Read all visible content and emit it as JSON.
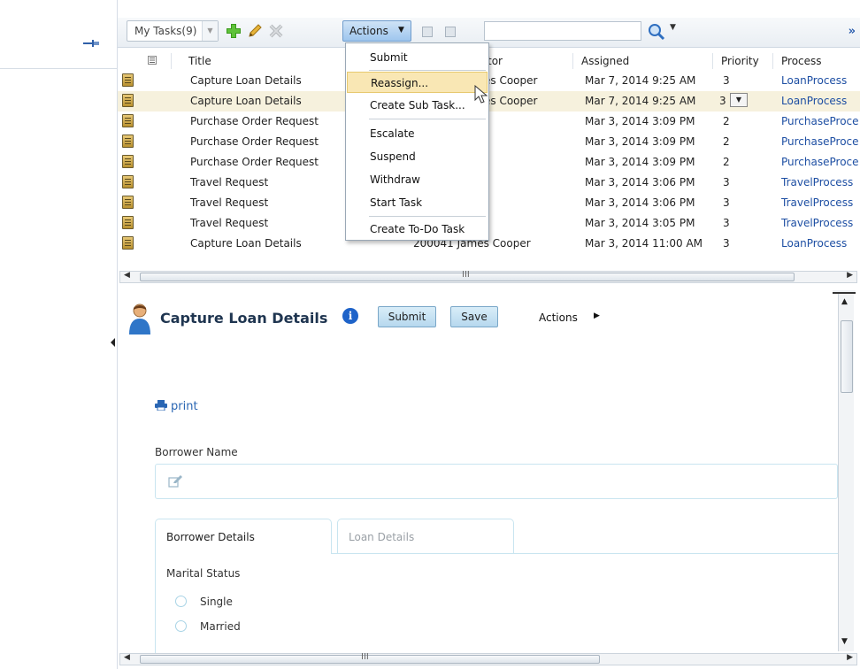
{
  "toolbar": {
    "task_filter": "My Tasks(9)",
    "actions_label": "Actions",
    "search_value": ""
  },
  "table": {
    "columns": [
      "Title",
      "tor",
      "Assigned",
      "Priority",
      "Process"
    ],
    "rows": [
      {
        "title": "Capture Loan Details",
        "creator": "es Cooper",
        "assigned": "Mar 7, 2014 9:25 AM",
        "priority": "3",
        "process": "LoanProcess"
      },
      {
        "title": "Capture Loan Details",
        "creator": "es Cooper",
        "assigned": "Mar 7, 2014 9:25 AM",
        "priority": "3",
        "process": "LoanProcess"
      },
      {
        "title": "Purchase Order Request",
        "creator": "",
        "assigned": "Mar 3, 2014 3:09 PM",
        "priority": "2",
        "process": "PurchaseProce"
      },
      {
        "title": "Purchase Order Request",
        "creator": "",
        "assigned": "Mar 3, 2014 3:09 PM",
        "priority": "2",
        "process": "PurchaseProce"
      },
      {
        "title": "Purchase Order Request",
        "creator": "",
        "assigned": "Mar 3, 2014 3:09 PM",
        "priority": "2",
        "process": "PurchaseProce"
      },
      {
        "title": "Travel Request",
        "creator": "",
        "assigned": "Mar 3, 2014 3:06 PM",
        "priority": "3",
        "process": "TravelProcess"
      },
      {
        "title": "Travel Request",
        "creator": "",
        "assigned": "Mar 3, 2014 3:06 PM",
        "priority": "3",
        "process": "TravelProcess"
      },
      {
        "title": "Travel Request",
        "creator": "",
        "assigned": "Mar 3, 2014 3:05 PM",
        "priority": "3",
        "process": "TravelProcess"
      },
      {
        "title": "Capture Loan Details",
        "creator": "200041 James Cooper",
        "assigned": "Mar 3, 2014 11:00 AM",
        "priority": "3",
        "process": "LoanProcess"
      }
    ]
  },
  "actions_menu": {
    "items": [
      "Submit",
      "Reassign...",
      "Create Sub Task...",
      "Escalate",
      "Suspend",
      "Withdraw",
      "Start Task",
      "Create To-Do Task"
    ],
    "highlighted": "Reassign..."
  },
  "scrollbar_grip": "III",
  "detail": {
    "title": "Capture Loan Details",
    "submit_label": "Submit",
    "save_label": "Save",
    "actions_label": "Actions",
    "print_label": "print",
    "borrower_name_label": "Borrower Name",
    "borrower_name_value": "",
    "tabs": [
      "Borrower Details",
      "Loan Details"
    ],
    "marital_status_label": "Marital Status",
    "marital_options": [
      "Single",
      "Married"
    ]
  },
  "colors": {
    "link": "#1e4fa3",
    "menu_highlight": "#f9e7b4",
    "actions_button": "#9ec6ee",
    "selected_row": "#f6f1dd",
    "title_text": "#1f3550"
  }
}
